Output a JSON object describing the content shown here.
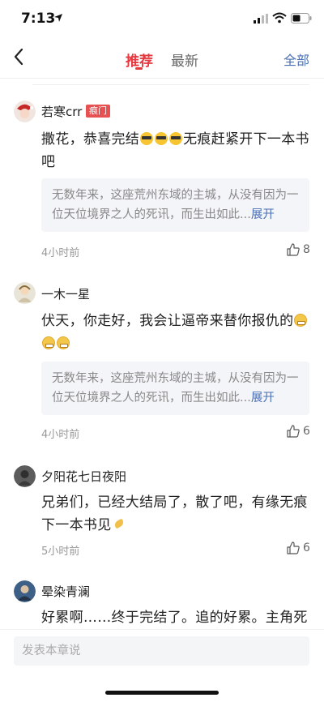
{
  "status_bar": {
    "time": "7:13"
  },
  "nav": {
    "tabs": [
      {
        "label": "推荐"
      },
      {
        "label": "最新"
      }
    ],
    "right_action": "全部"
  },
  "comments": [
    {
      "user": "若寒crr",
      "tag": "痕门",
      "text_before": "撒花，恭喜完结",
      "text_after": "无痕赶紧开下一本书吧",
      "quote": "无数年来，这座荒州东域的主城，从没有因为一位天位境界之人的死讯，而生出如此...",
      "expand": "展开",
      "time": "4小时前",
      "likes": "8"
    },
    {
      "user": "一木一星",
      "text": "伏天，你走好，我会让逼帝来替你报仇的",
      "quote": "无数年来，这座荒州东域的主城，从没有因为一位天位境界之人的死讯，而生出如此...",
      "expand": "展开",
      "time": "4小时前",
      "likes": "6"
    },
    {
      "user": "夕阳花七日夜阳",
      "text": "兄弟们，已经大结局了，散了吧，有缘无痕下一本书见",
      "time": "5小时前",
      "likes": "6"
    },
    {
      "user": "晕染青澜",
      "text": "好累啊……终于完结了。追的好累。主角死"
    }
  ],
  "input": {
    "placeholder": "发表本章说"
  },
  "colors": {
    "accent": "#e5383f",
    "link": "#4b6fb4"
  }
}
